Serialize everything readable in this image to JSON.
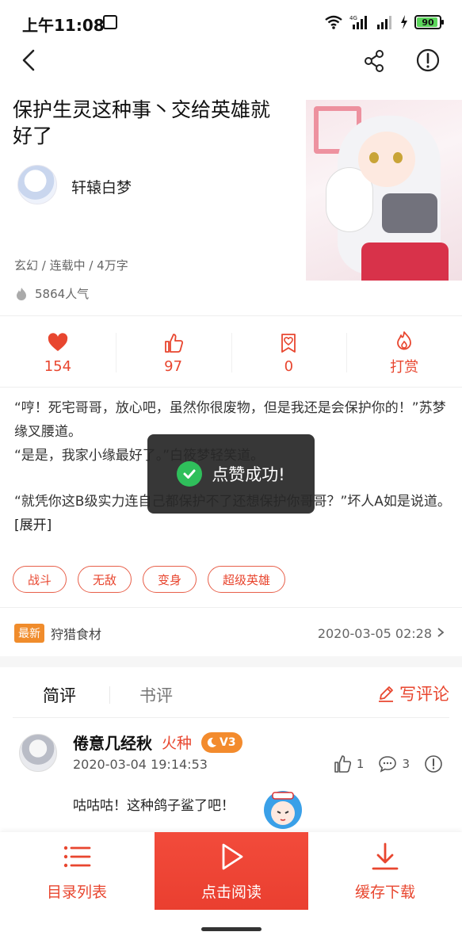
{
  "status_bar": {
    "time": "上午11:08",
    "battery": "90",
    "network": "4G"
  },
  "book": {
    "title": "保护生灵这种事丶交给英雄就好了",
    "author": "轩辕白梦",
    "meta": "玄幻 / 连载中 / 4万字",
    "popularity": "5864人气"
  },
  "stats": [
    {
      "icon": "heart-icon",
      "value": "154"
    },
    {
      "icon": "thumbs-up-icon",
      "value": "97"
    },
    {
      "icon": "bookmark-heart-icon",
      "value": "0"
    },
    {
      "icon": "flame-icon",
      "value": "打赏"
    }
  ],
  "synopsis": {
    "line1": "“哼！死宅哥哥，放心吧，虽然你很废物，但是我还是会保护你的！”苏梦缘叉腰道。",
    "line2": "“是是，我家小缘最好了。”白筱梦轻笑道。",
    "line3": "“就凭你这B级实力连自己都保护不了还想保护你哥哥？”坏人A如是说道。",
    "expand": "[展开]"
  },
  "toast": {
    "text": "点赞成功!"
  },
  "tags": [
    "战斗",
    "无敌",
    "变身",
    "超级英雄"
  ],
  "latest": {
    "badge": "最新",
    "chapter": "狩猎食材",
    "date": "2020-03-05 02:28"
  },
  "review_tabs": {
    "tab1": "简评",
    "tab2": "书评",
    "write": "写评论"
  },
  "comment": {
    "name": "倦意几经秋",
    "role": "火种",
    "level": "V3",
    "date": "2020-03-04 19:14:53",
    "likes": "1",
    "replies": "3",
    "text": "咕咕咕！这种鸽子鲨了吧！"
  },
  "bottom_bar": {
    "catalog": "目录列表",
    "read": "点击阅读",
    "download": "缓存下载"
  },
  "colors": {
    "accent": "#e8462f",
    "badge_orange": "#f08c2c",
    "toast_bg": "#282828",
    "success": "#2fbf5b"
  }
}
